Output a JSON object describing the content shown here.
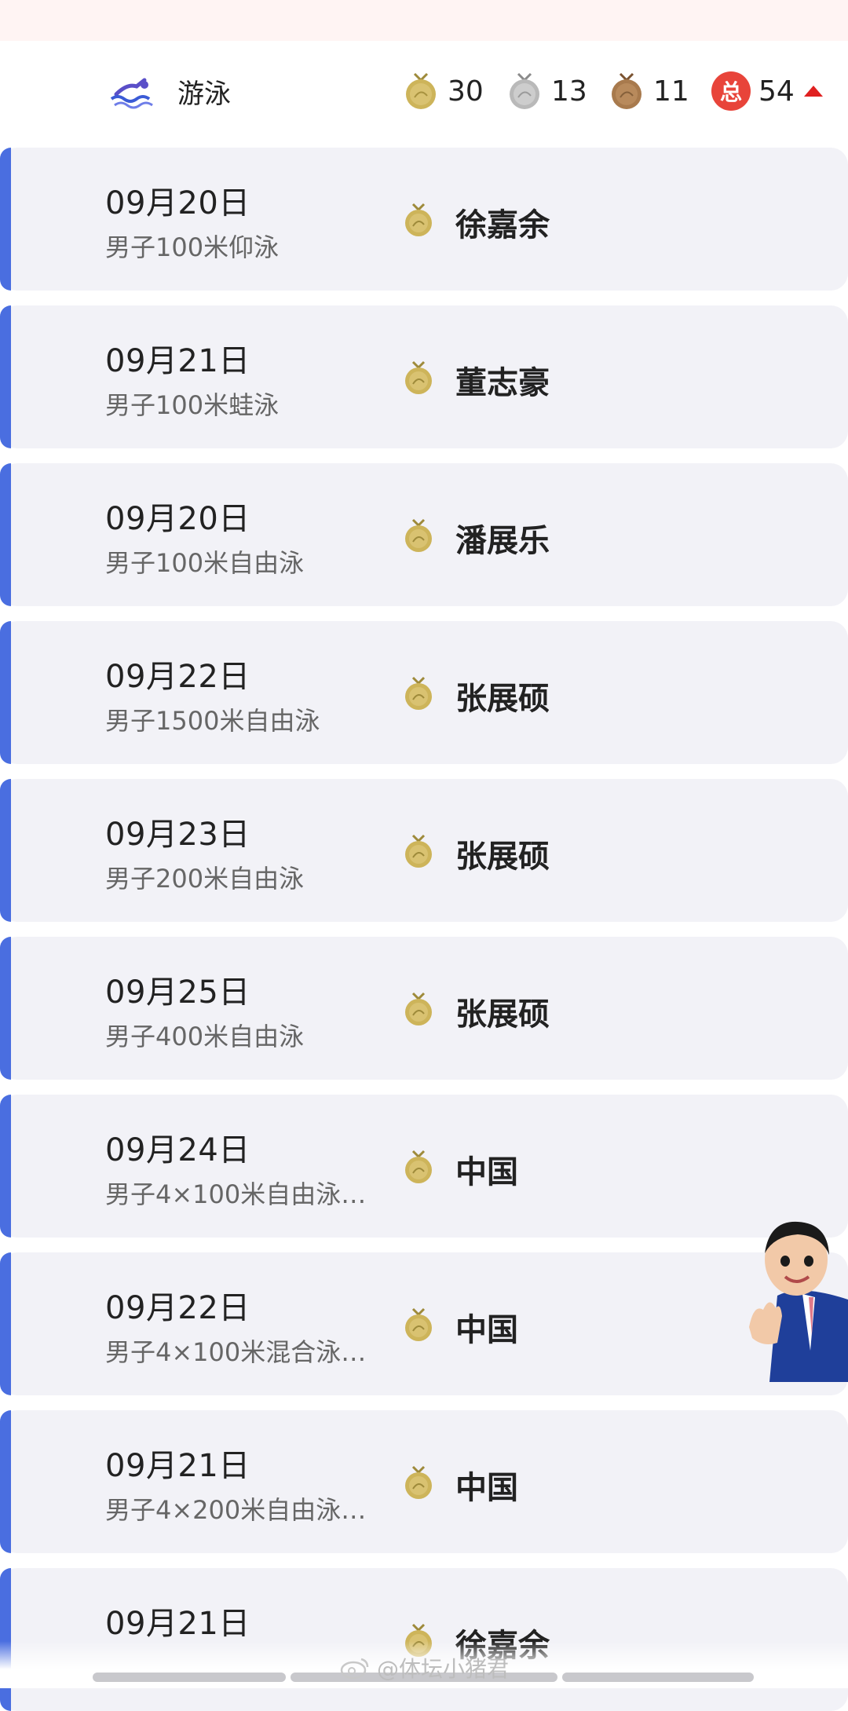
{
  "summary": {
    "sport_name": "游泳",
    "sport_icon": "swimming-icon",
    "gold_count": "30",
    "silver_count": "13",
    "bronze_count": "11",
    "total_badge": "总",
    "total_count": "54",
    "trend": "up"
  },
  "colors": {
    "accent": "#4a6ee0",
    "gold": "#cdb45a",
    "silver": "#b9b9b9",
    "bronze": "#a87a4d",
    "total_badge": "#e8443a"
  },
  "medals": [
    {
      "date": "09月20日",
      "event": "男子100米仰泳",
      "winner": "徐嘉余",
      "medal": "gold"
    },
    {
      "date": "09月21日",
      "event": "男子100米蛙泳",
      "winner": "董志豪",
      "medal": "gold"
    },
    {
      "date": "09月20日",
      "event": "男子100米自由泳",
      "winner": "潘展乐",
      "medal": "gold"
    },
    {
      "date": "09月22日",
      "event": "男子1500米自由泳",
      "winner": "张展硕",
      "medal": "gold"
    },
    {
      "date": "09月23日",
      "event": "男子200米自由泳",
      "winner": "张展硕",
      "medal": "gold"
    },
    {
      "date": "09月25日",
      "event": "男子400米自由泳",
      "winner": "张展硕",
      "medal": "gold"
    },
    {
      "date": "09月24日",
      "event": "男子4×100米自由泳…",
      "winner": "中国",
      "medal": "gold"
    },
    {
      "date": "09月22日",
      "event": "男子4×100米混合泳…",
      "winner": "中国",
      "medal": "gold"
    },
    {
      "date": "09月21日",
      "event": "男子4×200米自由泳…",
      "winner": "中国",
      "medal": "gold"
    },
    {
      "date": "09月21日",
      "event": "",
      "winner": "徐嘉余",
      "medal": "gold"
    }
  ],
  "watermark": "@体坛小猪君"
}
